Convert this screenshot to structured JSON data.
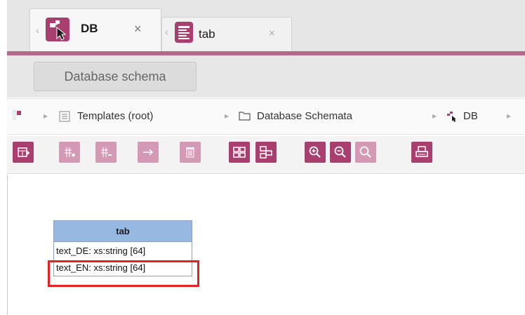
{
  "tabs": [
    {
      "label": "DB",
      "close": "×",
      "arrow": "‹",
      "icon": "db-schema-icon"
    },
    {
      "label": "tab",
      "close": "×",
      "arrow": "‹",
      "icon": "table-template-icon"
    }
  ],
  "header": {
    "schema_button": "Database schema"
  },
  "breadcrumb": {
    "items": [
      {
        "label": "",
        "icon": "root-icon"
      },
      {
        "label": "Templates (root)",
        "icon": "templates-icon"
      },
      {
        "label": "Database Schemata",
        "icon": "folder-icon"
      },
      {
        "label": "DB",
        "icon": "db-schema-icon"
      }
    ],
    "separator": "▸"
  },
  "toolbar": {
    "buttons": [
      {
        "name": "add-table",
        "enabled": true
      },
      {
        "name": "add-column",
        "enabled": false
      },
      {
        "name": "remove-column",
        "enabled": false
      },
      {
        "name": "add-relation",
        "enabled": false
      },
      {
        "name": "delete",
        "enabled": false
      },
      {
        "name": "layout-grid",
        "enabled": true
      },
      {
        "name": "layout-auto",
        "enabled": true
      },
      {
        "name": "zoom-in",
        "enabled": true
      },
      {
        "name": "zoom-out",
        "enabled": true
      },
      {
        "name": "zoom-reset",
        "enabled": false
      },
      {
        "name": "print",
        "enabled": true
      }
    ]
  },
  "diagram": {
    "table_name": "tab",
    "columns": [
      "text_DE: xs:string [64]",
      "text_EN: xs:string [64]"
    ],
    "highlight_color": "#e52222"
  },
  "colors": {
    "accent": "#a83f6f",
    "accent_disabled": "#d49ab5",
    "table_header": "#97b8e0"
  }
}
